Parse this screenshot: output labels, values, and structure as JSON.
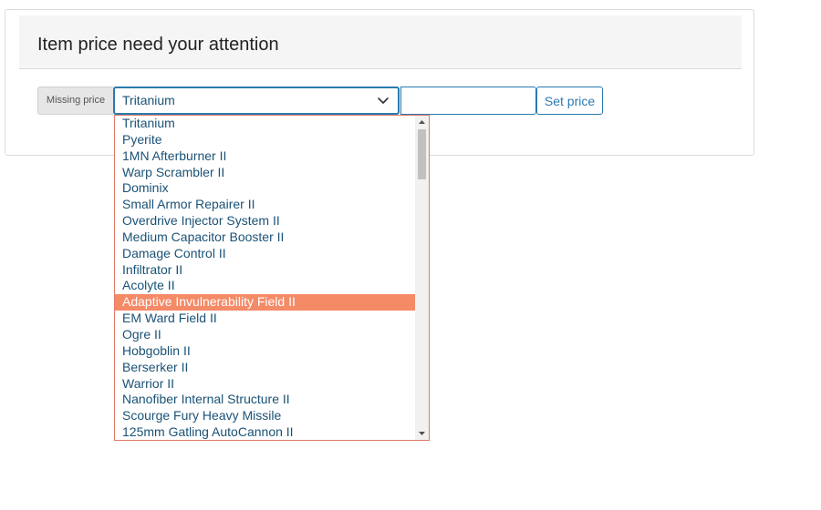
{
  "panel": {
    "title": "Item price need your attention"
  },
  "form": {
    "addon_label": "Missing price",
    "selected_item": "Tritanium",
    "price_value": "",
    "set_price_label": "Set price"
  },
  "dropdown": {
    "highlighted_index": 11,
    "options": [
      "Tritanium",
      "Pyerite",
      "1MN Afterburner II",
      "Warp Scrambler II",
      "Dominix",
      "Small Armor Repairer II",
      "Overdrive Injector System II",
      "Medium Capacitor Booster II",
      "Damage Control II",
      "Infiltrator II",
      "Acolyte II",
      "Adaptive Invulnerability Field II",
      "EM Ward Field II",
      "Ogre II",
      "Hobgoblin II",
      "Berserker II",
      "Warrior II",
      "Nanofiber Internal Structure II",
      "Scourge Fury Heavy Missile",
      "125mm Gatling AutoCannon II"
    ]
  },
  "colors": {
    "accent": "#2a7ab0",
    "highlight": "#f58a67",
    "option_text": "#1a5276"
  },
  "icons": {
    "select_toggle": "chevron-down-icon",
    "scroll_up": "scroll-up-arrow-icon",
    "scroll_down": "scroll-down-arrow-icon"
  }
}
